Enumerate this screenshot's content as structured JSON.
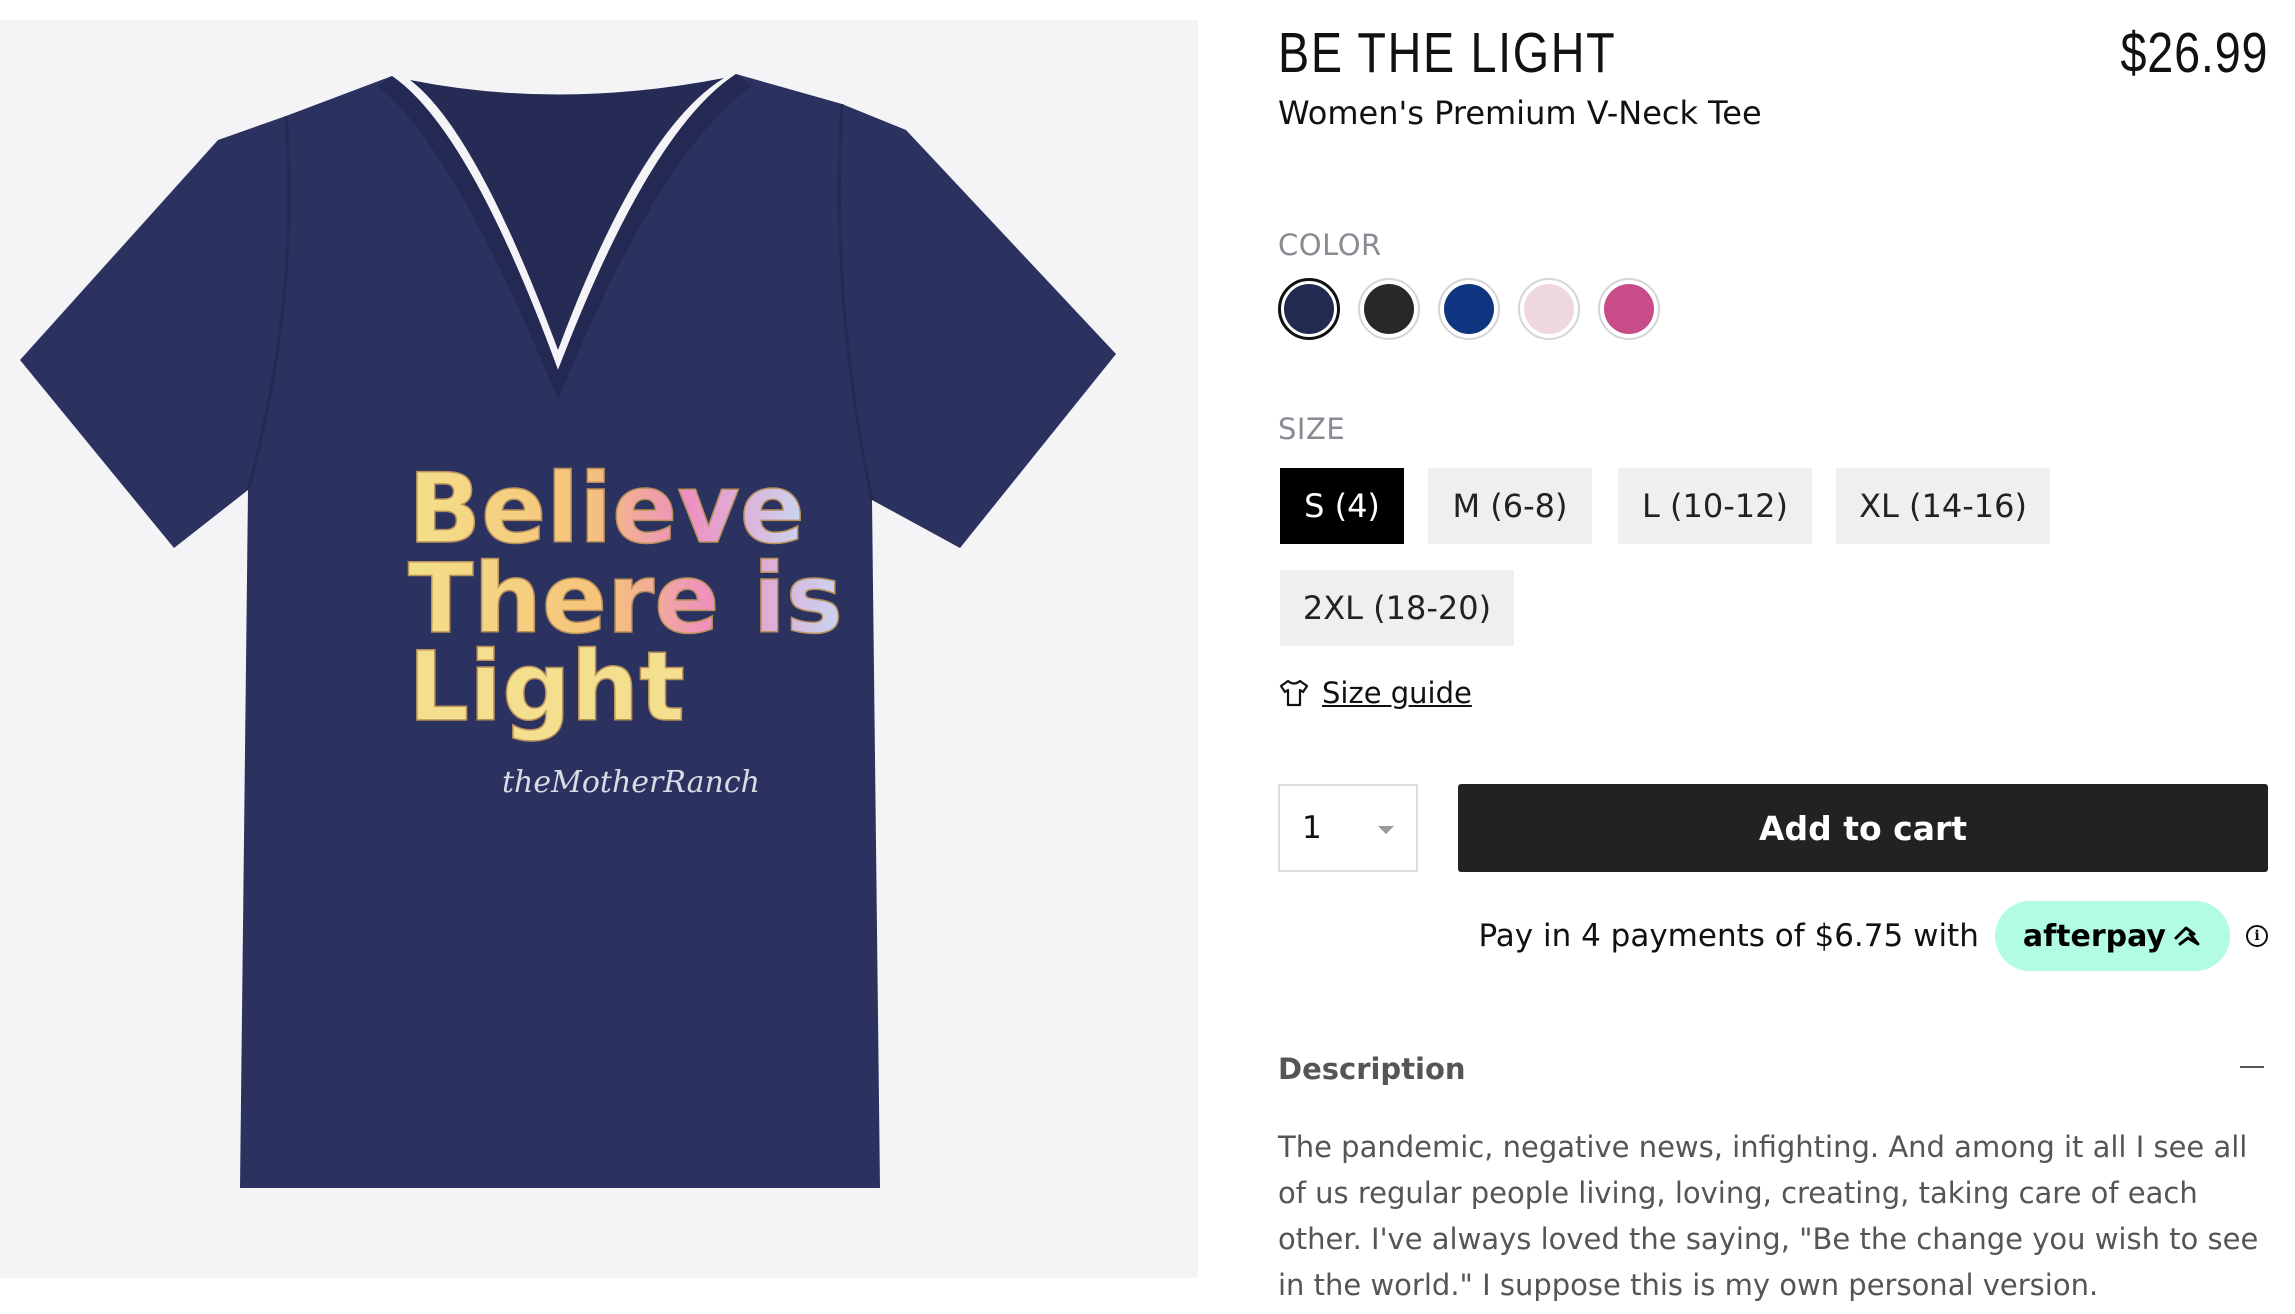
{
  "product": {
    "title": "BE THE LIGHT",
    "price": "$26.99",
    "subtitle": "Women's Premium V-Neck Tee"
  },
  "image": {
    "alt_shirt_color": "#2b325f",
    "print_lines": [
      "Believe",
      "There is",
      "Light"
    ],
    "signature": "theMotherRanch"
  },
  "color": {
    "label": "COLOR",
    "options": [
      {
        "name": "navy",
        "hex": "#232a52",
        "selected": true
      },
      {
        "name": "black",
        "hex": "#26282a",
        "selected": false
      },
      {
        "name": "royal",
        "hex": "#0f3580",
        "selected": false
      },
      {
        "name": "light-pink",
        "hex": "#efd8dd",
        "selected": false
      },
      {
        "name": "pink",
        "hex": "#c94c8a",
        "selected": false
      }
    ]
  },
  "size": {
    "label": "SIZE",
    "options": [
      {
        "label": "S (4)",
        "selected": true
      },
      {
        "label": "M (6-8)",
        "selected": false
      },
      {
        "label": "L (10-12)",
        "selected": false
      },
      {
        "label": "XL (14-16)",
        "selected": false
      },
      {
        "label": "2XL (18-20)",
        "selected": false
      }
    ],
    "guide_label": "Size guide",
    "guide_icon": "tshirt-icon"
  },
  "purchase": {
    "quantity": "1",
    "add_to_cart_label": "Add to cart"
  },
  "afterpay": {
    "text": "Pay in 4 payments of $6.75 with",
    "brand": "afterpay",
    "badge_color": "#b2fce4",
    "info_icon": "info-icon"
  },
  "description": {
    "heading": "Description",
    "body": "The pandemic, negative news, infighting. And among it all I see all of us regular people living, loving, creating, taking care of each other. I've always loved the saying, \"Be the change you wish to see in the world.\" I suppose this is my own personal version."
  }
}
